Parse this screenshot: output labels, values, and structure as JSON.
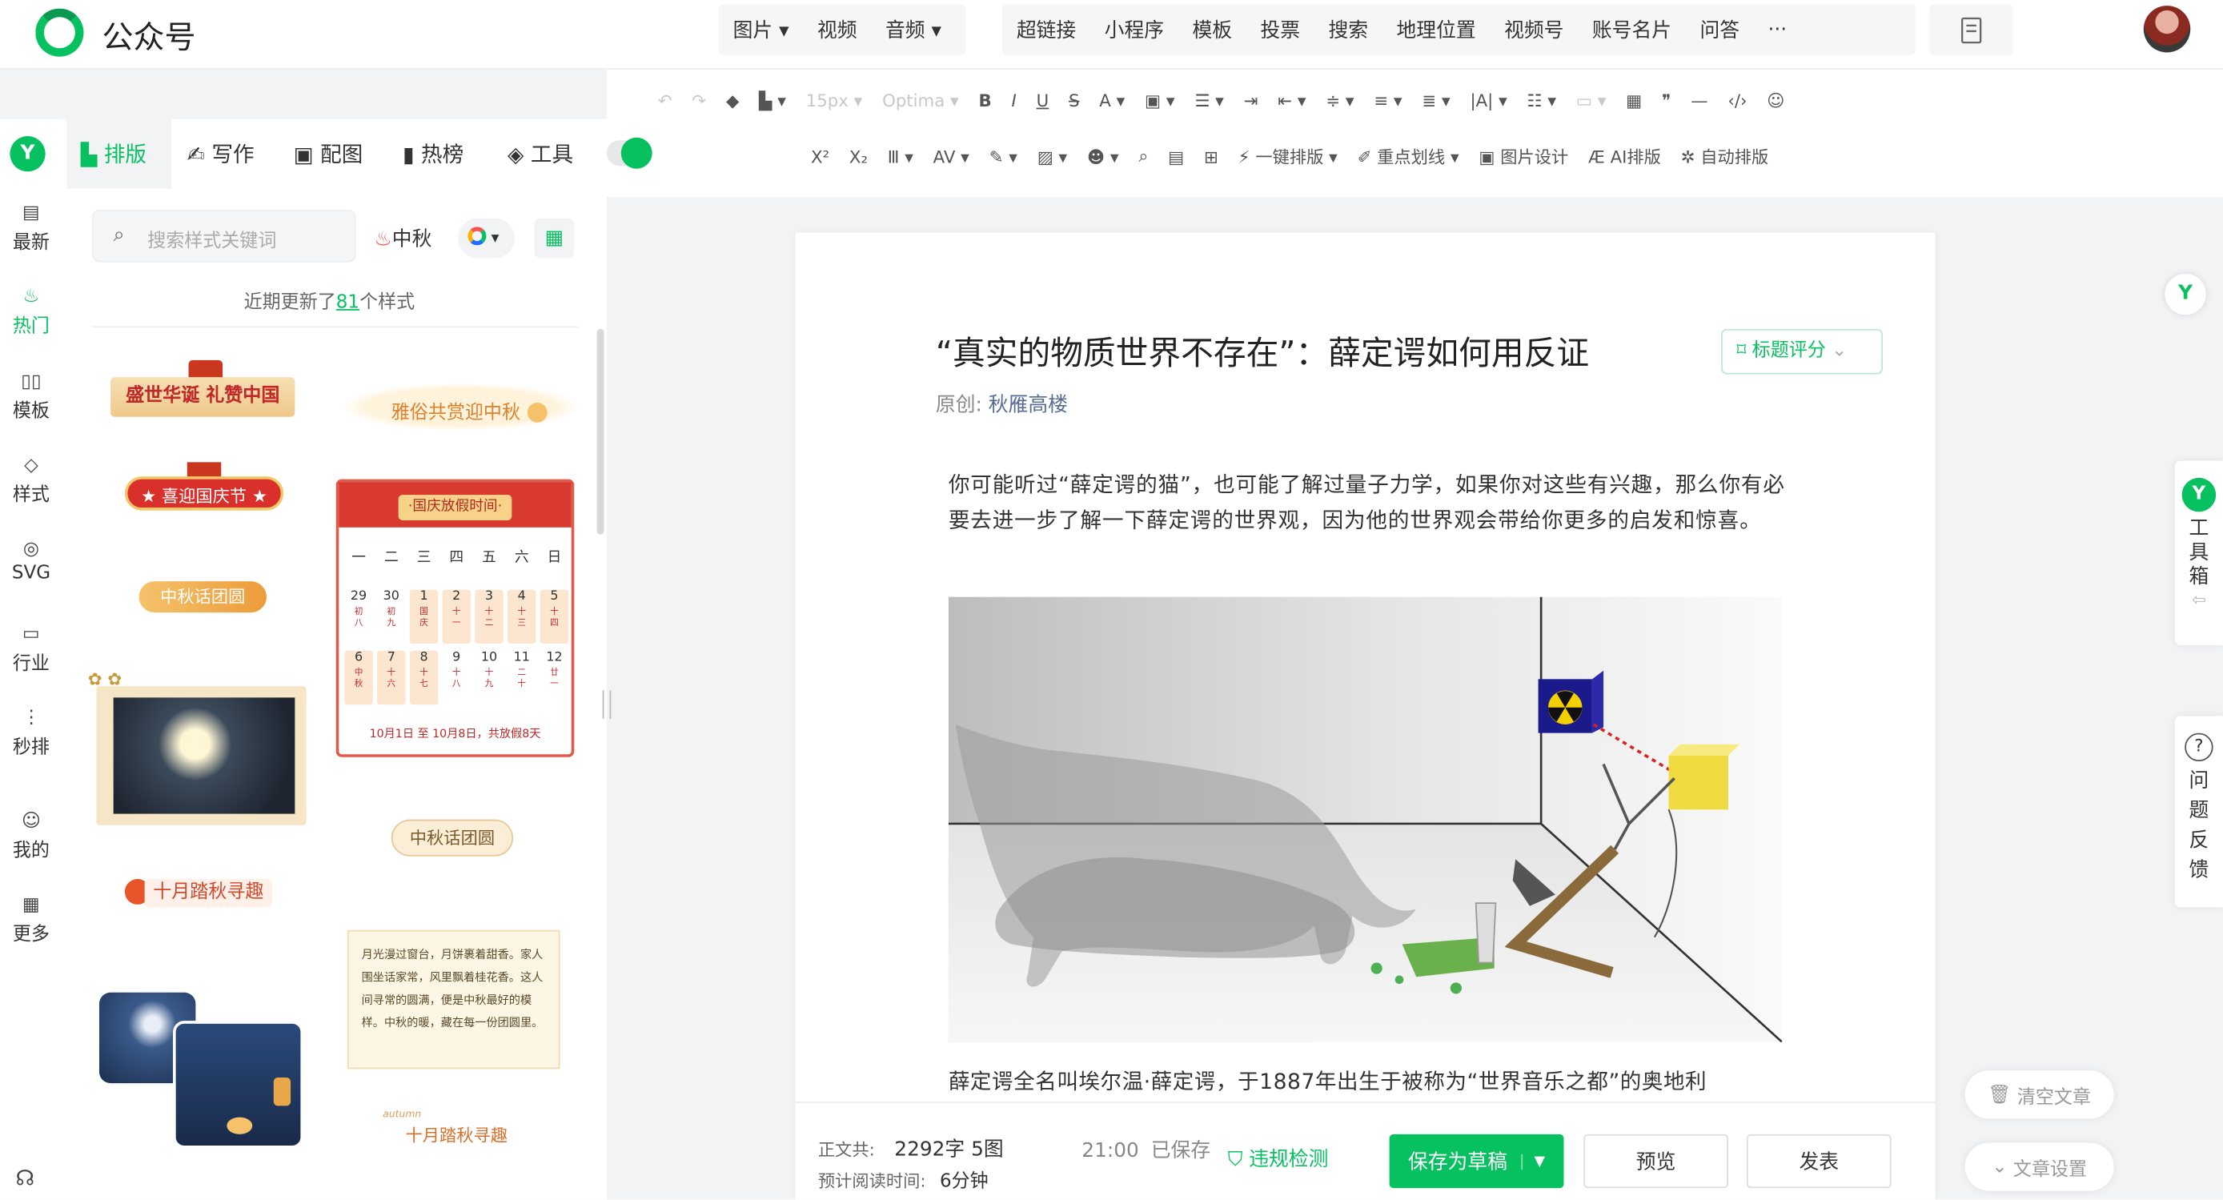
{
  "app": {
    "name": "公众号"
  },
  "top_media": [
    "图片",
    "视频",
    "音频"
  ],
  "top_tools": [
    {
      "label": "超链接",
      "dot": false
    },
    {
      "label": "小程序",
      "dot": false
    },
    {
      "label": "模板",
      "dot": false
    },
    {
      "label": "投票",
      "dot": false
    },
    {
      "label": "搜索",
      "dot": false
    },
    {
      "label": "地理位置",
      "dot": false
    },
    {
      "label": "视频号",
      "dot": true
    },
    {
      "label": "账号名片",
      "dot": true
    },
    {
      "label": "问答",
      "dot": true
    },
    {
      "label": "···",
      "dot": false
    }
  ],
  "format_toolbar": {
    "font_size": "15px",
    "font_family": "Optima"
  },
  "format_toolbar2": {
    "one_click": "一键排版",
    "highlight": "重点划线",
    "image_design": "图片设计",
    "ai_layout": "AI排版",
    "auto_layout": "自动排版"
  },
  "leftnav": [
    {
      "label": "最新",
      "icon": "news-icon"
    },
    {
      "label": "热门",
      "icon": "flame-icon",
      "active": true
    },
    {
      "label": "模板",
      "icon": "template-icon"
    },
    {
      "label": "样式",
      "icon": "style-icon"
    },
    {
      "label": "SVG",
      "icon": "svg-icon"
    },
    {
      "label": "行业",
      "icon": "industry-icon"
    },
    {
      "label": "秒排",
      "icon": "quick-icon"
    },
    {
      "label": "我的",
      "icon": "user-icon"
    },
    {
      "label": "更多",
      "icon": "grid-icon"
    }
  ],
  "panel": {
    "tabs": [
      "排版",
      "写作",
      "配图",
      "热榜",
      "工具"
    ],
    "search_placeholder": "搜索样式关键词",
    "hot_tag": "中秋",
    "update_prefix": "近期更新了",
    "update_count": "81",
    "update_suffix": "个样式",
    "cards": {
      "c1": "盛世华诞 礼赞中国",
      "c2": "雅俗共赏迎中秋",
      "c3": "★ 喜迎国庆节 ★",
      "c4": "中秋话团圆",
      "cal_title": "·国庆放假时间·",
      "cal_week": [
        "一",
        "二",
        "三",
        "四",
        "五",
        "六",
        "日"
      ],
      "cal_row1": [
        "29",
        "30",
        "1",
        "2",
        "3",
        "4",
        "5"
      ],
      "cal_row1_sub": [
        "初八",
        "初九",
        "国庆",
        "十一",
        "十二",
        "十三",
        "十四"
      ],
      "cal_row2": [
        "6",
        "7",
        "8",
        "9",
        "10",
        "11",
        "12"
      ],
      "cal_row2_sub": [
        "中秋",
        "十六",
        "十七",
        "十八",
        "十九",
        "二十",
        "廿一"
      ],
      "cal_note": "10月1日 至 10月8日，共放假8天",
      "c6": "中秋话团圆",
      "c7": "十月踏秋寻趣",
      "c8_text": "月光漫过窗台，月饼裹着甜香。家人围坐话家常，风里飘着桂花香。这人间寻常的圆满，便是中秋最好的模样。中秋的暖，藏在每一份团圆里。",
      "c9": "十月踏秋寻趣",
      "c9_small": "autumn"
    }
  },
  "article": {
    "title": "“真实的物质世界不存在”：薛定谔如何用反证",
    "title_score": "标题评分",
    "author_label": "原创:",
    "author": "秋雁高楼",
    "para1": "你可能听过“薛定谔的猫”，也可能了解过量子力学，如果你对这些有兴趣，那么你有必要去进一步了解一下薛定谔的世界观，因为他的世界观会带给你更多的启发和惊喜。",
    "para2": "薛定谔全名叫埃尔温·薛定谔，于1887年出生于被称为“世界音乐之都”的奥地利"
  },
  "bottom": {
    "body_label": "正文共:",
    "body_value": "2292字 5图",
    "read_label": "预计阅读时间:",
    "read_value": "6分钟",
    "save_time": "21:00",
    "save_status": "已保存",
    "compliance": "违规检测",
    "save_draft": "保存为草稿",
    "preview": "预览",
    "publish": "发表"
  },
  "right": {
    "toolbox": "工具箱",
    "feedback": "问题反馈",
    "clear": "清空文章",
    "settings": "文章设置"
  },
  "colors": {
    "accent": "#07c160",
    "red": "#fa5151",
    "link": "#576b95"
  }
}
